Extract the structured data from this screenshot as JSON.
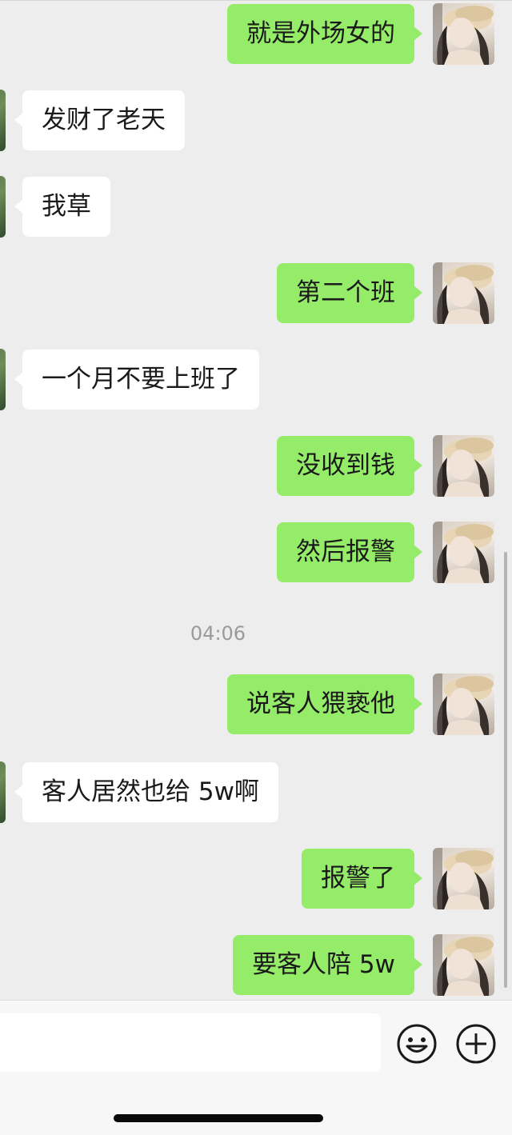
{
  "messages": [
    {
      "side": "out",
      "text": "就是外场女的"
    },
    {
      "side": "in",
      "text": "发财了老天"
    },
    {
      "side": "in",
      "text": "我草"
    },
    {
      "side": "out",
      "text": "第二个班"
    },
    {
      "side": "in",
      "text": "一个月不要上班了"
    },
    {
      "side": "out",
      "text": "没收到钱"
    },
    {
      "side": "out",
      "text": "然后报警"
    },
    {
      "side": "out",
      "text": "说客人猥亵他"
    },
    {
      "side": "in",
      "text": "客人居然也给 5w啊"
    },
    {
      "side": "out",
      "text": "报警了"
    },
    {
      "side": "out",
      "text": "要客人陪 5w"
    }
  ],
  "timestamp": "04:06",
  "input_bar": {
    "text_value": "",
    "emoji_icon": "smiley-face-icon",
    "more_icon": "plus-circle-icon"
  },
  "colors": {
    "chat_background": "#ededed",
    "outgoing_bubble": "#95ec69",
    "incoming_bubble": "#ffffff",
    "timestamp_text": "#9a9a9a"
  }
}
